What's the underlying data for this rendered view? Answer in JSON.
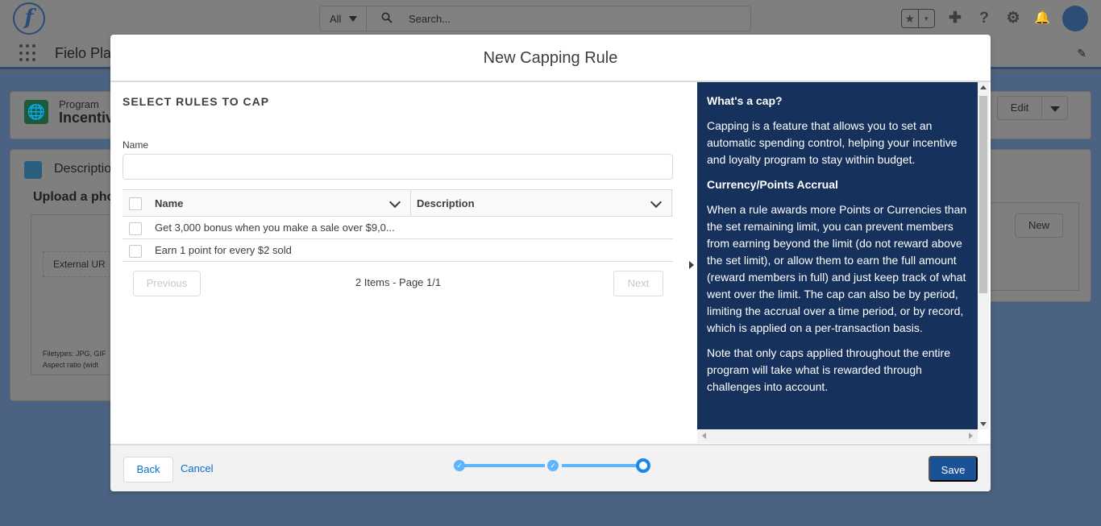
{
  "header": {
    "logo_letter": "f",
    "search_scope": "All",
    "search_placeholder": "Search...",
    "fav_star": "★",
    "fav_caret": "▾",
    "add_glyph": "✚",
    "help_glyph": "?",
    "setup_glyph": "⚙",
    "notif_glyph": "🔔"
  },
  "nav": {
    "app_name": "Fielo Pla",
    "edit_glyph": "✎"
  },
  "record": {
    "type": "Program",
    "name": "Incentiv",
    "edit_label": "Edit",
    "globe_glyph": "🌐"
  },
  "description_card": {
    "title": "Descriptio",
    "upload_title": "Upload a pho",
    "external_url": "External UR",
    "filetypes_line1": "Filetypes: JPG, GIF",
    "filetypes_line2": "Aspect ratio (widt"
  },
  "related": {
    "new_label": "New"
  },
  "modal": {
    "title": "New Capping Rule",
    "section_title": "SELECT RULES TO CAP",
    "name_label": "Name",
    "name_value": "",
    "table": {
      "col_name": "Name",
      "col_description": "Description",
      "rows": [
        {
          "name": "Get 3,000 bonus when you make a sale over $9,0...",
          "description": ""
        },
        {
          "name": "Earn 1 point for every $2 sold",
          "description": ""
        }
      ]
    },
    "pager": {
      "previous": "Previous",
      "info": "2 Items - Page 1/1",
      "next": "Next"
    },
    "help": {
      "heading1": "What's a cap?",
      "para1": "Capping is a feature that allows you to set an automatic spending control, helping your incentive and loyalty program to stay within budget.",
      "heading2": "Currency/Points Accrual",
      "para2": "When a rule awards more Points or Currencies than the set remaining limit, you can prevent members from earning beyond the limit (do not reward above the set limit), or allow them to earn the full amount (reward members in full) and just keep track of what went over the limit. The cap can also be by period, limiting the accrual over a time period, or by record, which is applied on a per-transaction basis.",
      "para3": "Note that only caps applied throughout the entire program will take what is rewarded through challenges into account."
    },
    "footer": {
      "back": "Back",
      "cancel": "Cancel",
      "save": "Save",
      "steps": [
        {
          "state": "complete",
          "glyph": "✓"
        },
        {
          "state": "complete",
          "glyph": "✓"
        },
        {
          "state": "active",
          "glyph": ""
        }
      ]
    }
  },
  "colors": {
    "brand_button": "#1b5297",
    "help_panel_bg": "#16325c",
    "progress": "#5eb4ff",
    "link": "#0070d2"
  }
}
